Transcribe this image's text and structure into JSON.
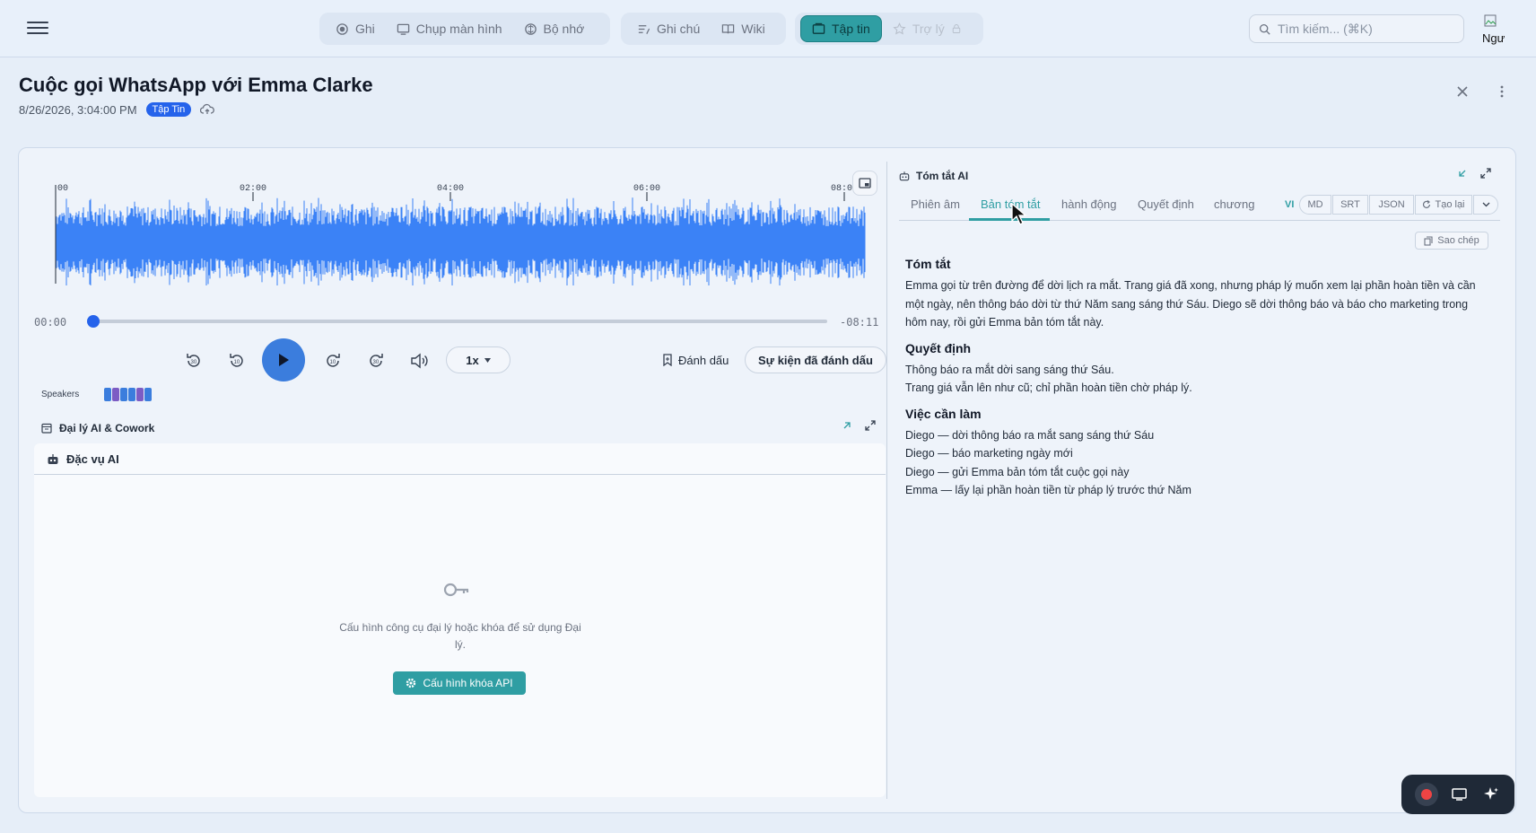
{
  "nav": {
    "group1": [
      {
        "label": "Ghi",
        "icon": "record-icon"
      },
      {
        "label": "Chụp màn hình",
        "icon": "monitor-icon"
      },
      {
        "label": "Bộ nhớ",
        "icon": "brain-icon"
      }
    ],
    "group2": [
      {
        "label": "Ghi chú",
        "icon": "note-icon"
      },
      {
        "label": "Wiki",
        "icon": "book-icon"
      }
    ],
    "group3": [
      {
        "label": "Tập tin",
        "icon": "folder-icon",
        "active": true
      },
      {
        "label": "Trợ lý",
        "icon": "star-icon",
        "disabled": true
      }
    ]
  },
  "search": {
    "placeholder": "Tìm kiếm... (⌘K)"
  },
  "avatar": {
    "alt": "Ngư"
  },
  "page": {
    "title": "Cuộc gọi WhatsApp với Emma Clarke",
    "date": "8/26/2026, 3:04:00 PM",
    "badge": "Tập Tin"
  },
  "player": {
    "ruler": [
      "00",
      "02:00",
      "04:00",
      "06:00",
      "08:0"
    ],
    "current_time": "00:00",
    "remaining_time": "-08:11",
    "progress": 0.0,
    "speed": "1x",
    "mark_label": "Đánh dấu",
    "marked_events_label": "Sự kiện đã đánh dấu",
    "speakers_label": "Speakers",
    "wave_color": "#3b82f6"
  },
  "speakers": [
    "#3b7ddd",
    "#7c5cc4",
    "#3b7ddd",
    "#3b7ddd",
    "#7c5cc4",
    "#3b7ddd"
  ],
  "agent": {
    "section_title": "Đại lý AI & Cowork",
    "box_title": "Đặc vụ AI",
    "empty_text": "Cấu hình công cụ đại lý hoặc khóa để sử dụng Đại lý.",
    "api_button": "Cấu hình khóa API"
  },
  "ai_summary": {
    "title": "Tóm tắt AI",
    "tabs": [
      "Phiên âm",
      "Bản tóm tắt",
      "hành động",
      "Quyết định",
      "chương"
    ],
    "active_tab": 1,
    "lang": "VI",
    "formats": [
      "MD",
      "SRT",
      "JSON"
    ],
    "regenerate": "Tạo lại",
    "copy": "Sao chép",
    "sections": [
      {
        "heading": "Tóm tắt",
        "lines": [
          "Emma gọi từ trên đường để dời lịch ra mắt. Trang giá đã xong, nhưng pháp lý muốn xem lại phần hoàn tiền và cần một ngày, nên thông báo dời từ thứ Năm sang sáng thứ Sáu. Diego sẽ dời thông báo và báo cho marketing trong hôm nay, rồi gửi Emma bản tóm tắt này."
        ]
      },
      {
        "heading": "Quyết định",
        "lines": [
          "Thông báo ra mắt dời sang sáng thứ Sáu.",
          "Trang giá vẫn lên như cũ; chỉ phần hoàn tiền chờ pháp lý."
        ]
      },
      {
        "heading": "Việc cần làm",
        "lines": [
          "Diego — dời thông báo ra mắt sang sáng thứ Sáu",
          "Diego — báo marketing ngày mới",
          "Diego — gửi Emma bản tóm tắt cuộc gọi này",
          "Emma — lấy lại phần hoàn tiền từ pháp lý trước thứ Năm"
        ]
      }
    ]
  },
  "colors": {
    "accent": "#2f9ea3",
    "primary": "#2563eb",
    "record": "#ef4444"
  }
}
